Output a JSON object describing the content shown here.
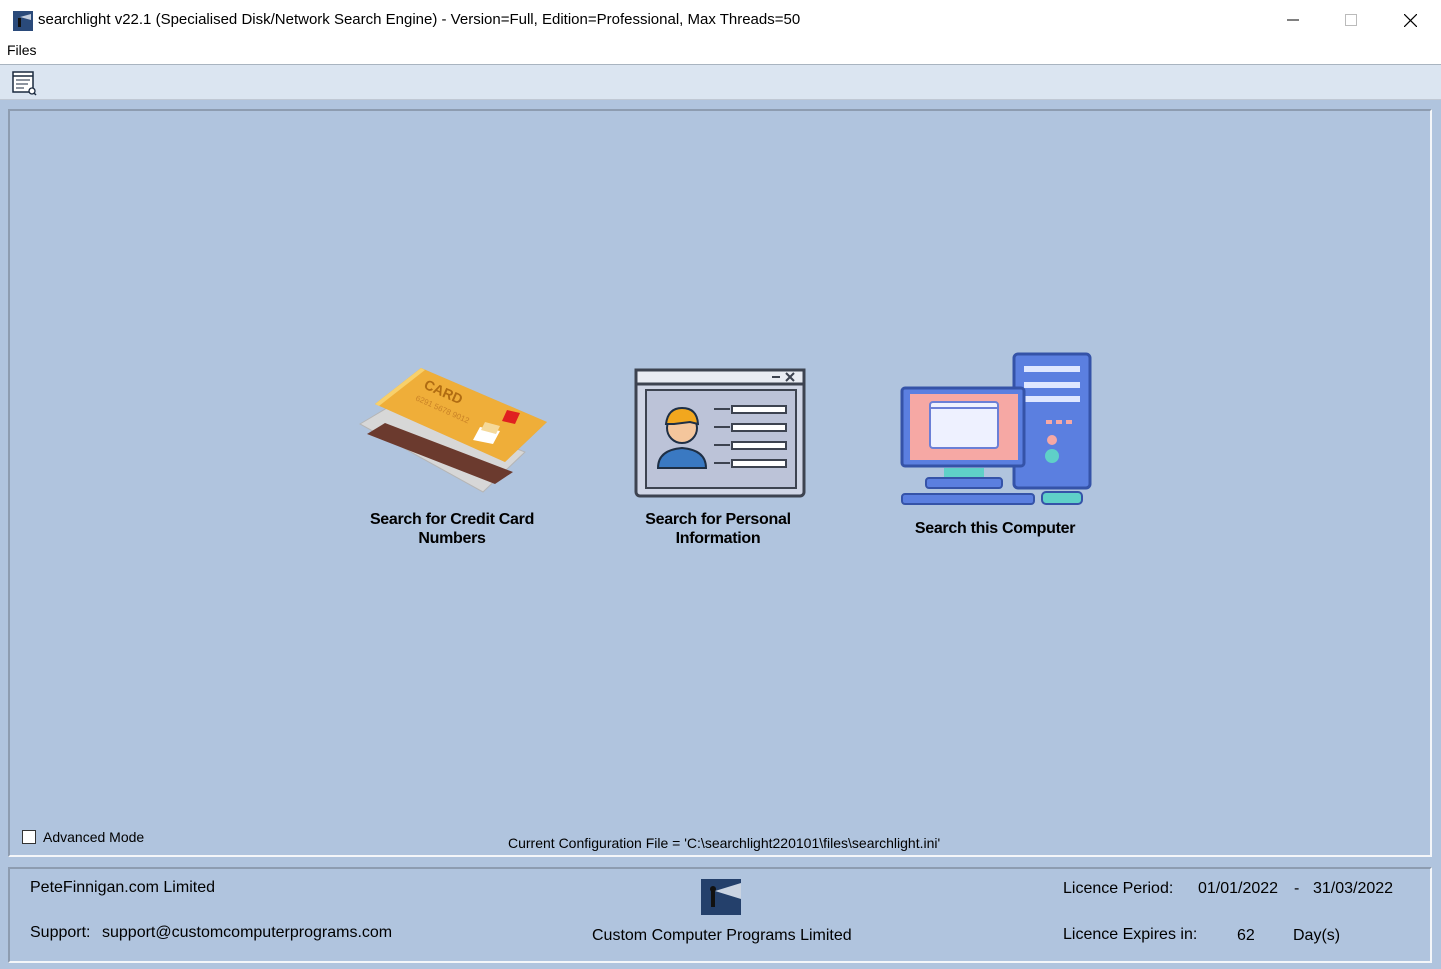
{
  "window": {
    "title": "searchlight v22.1 (Specialised Disk/Network Search Engine) - Version=Full, Edition=Professional, Max Threads=50",
    "icon": "searchlight-app-icon"
  },
  "menu": {
    "files": "Files"
  },
  "toolbar": {
    "icon": "report-icon"
  },
  "tiles": [
    {
      "label_line1": "Search for Credit Card",
      "label_line2": "Numbers",
      "icon": "credit-card-icon",
      "card_text": "CARD",
      "card_number": "6291 5678 9012"
    },
    {
      "label_line1": "Search for Personal",
      "label_line2": "Information",
      "icon": "personal-id-icon"
    },
    {
      "label_line1": "Search this Computer",
      "icon": "desktop-computer-icon"
    }
  ],
  "advanced_mode": {
    "label": "Advanced Mode",
    "checked": false
  },
  "config_file": "Current Configuration File = 'C:\\searchlight220101\\files\\searchlight.ini'",
  "footer": {
    "company": "PeteFinnigan.com Limited",
    "support_label": "Support:",
    "support_email": "support@customcomputerprograms.com",
    "vendor": "Custom Computer Programs Limited",
    "licence_period_label": "Licence Period:",
    "licence_start": "01/01/2022",
    "licence_sep": "-",
    "licence_end": "31/03/2022",
    "expires_label": "Licence Expires in:",
    "expires_value": "62",
    "expires_unit": "Day(s)"
  },
  "colors": {
    "background": "#b0c4de",
    "toolbar": "#dbe5f1",
    "monitor": "#5b7fe0",
    "screen": "#f6a8a4"
  }
}
